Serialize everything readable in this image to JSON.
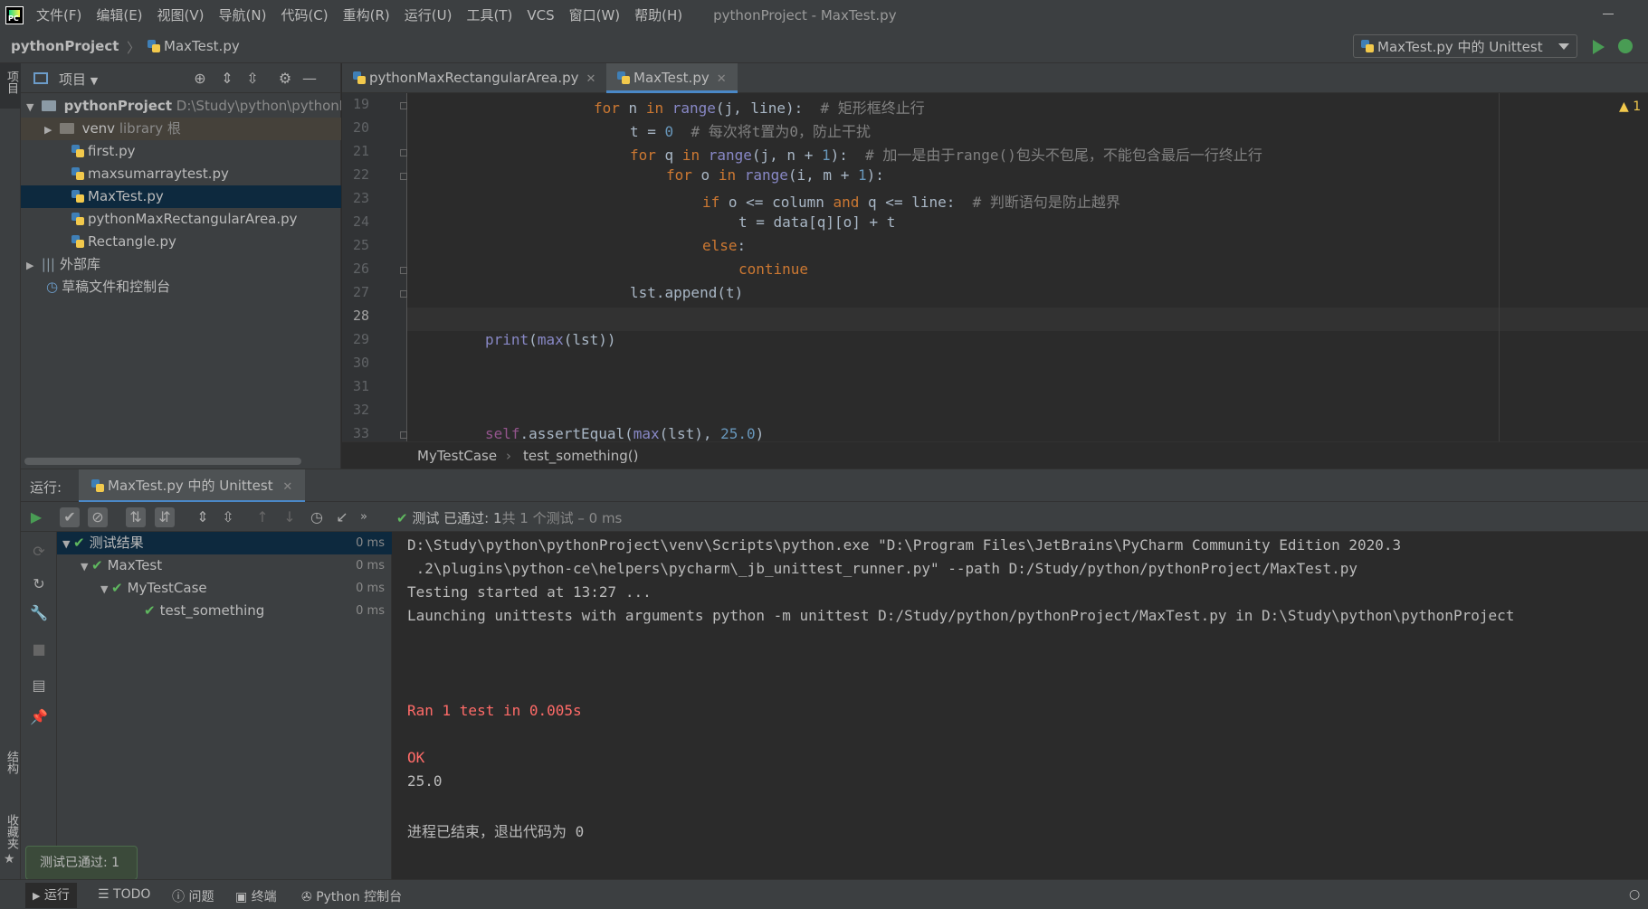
{
  "menubar": {
    "items": [
      "文件(F)",
      "编辑(E)",
      "视图(V)",
      "导航(N)",
      "代码(C)",
      "重构(R)",
      "运行(U)",
      "工具(T)",
      "VCS",
      "窗口(W)",
      "帮助(H)"
    ],
    "window_title": "pythonProject - MaxTest.py",
    "logo_text": "PC"
  },
  "navbar": {
    "project": "pythonProject",
    "separator": "〉",
    "file": "MaxTest.py",
    "run_config": "MaxTest.py 中的 Unittest"
  },
  "left_strip": {
    "project_label": "项目",
    "structure_label": "结构",
    "favorites_label": "收藏夹"
  },
  "project_panel": {
    "title": "项目",
    "tree": [
      {
        "label": "pythonProject",
        "suffix": "D:\\Study\\python\\pythonP"
      },
      {
        "label": "venv",
        "suffix": "library 根"
      },
      {
        "label": "first.py",
        "suffix": ""
      },
      {
        "label": "maxsumarraytest.py",
        "suffix": ""
      },
      {
        "label": "MaxTest.py",
        "suffix": ""
      },
      {
        "label": "pythonMaxRectangularArea.py",
        "suffix": ""
      },
      {
        "label": "Rectangle.py",
        "suffix": ""
      },
      {
        "label": "外部库",
        "suffix": ""
      },
      {
        "label": "草稿文件和控制台",
        "suffix": ""
      }
    ]
  },
  "editor": {
    "tabs": [
      "pythonMaxRectangularArea.py",
      "MaxTest.py"
    ],
    "line_numbers": [
      "19",
      "20",
      "21",
      "22",
      "23",
      "24",
      "25",
      "26",
      "27",
      "28",
      "29",
      "30",
      "31",
      "32",
      "33"
    ],
    "warning": "1",
    "breadcrumb": [
      "MyTestCase",
      "test_something()"
    ]
  },
  "run_panel": {
    "label": "运行:",
    "tab": "MaxTest.py 中的 Unittest",
    "status_prefix": "测试 已通过:",
    "status_count": "1",
    "status_suffix": "共 1 个测试 – 0 ms",
    "results": [
      {
        "label": "测试结果",
        "time": "0 ms"
      },
      {
        "label": "MaxTest",
        "time": "0 ms"
      },
      {
        "label": "MyTestCase",
        "time": "0 ms"
      },
      {
        "label": "test_something",
        "time": "0 ms"
      }
    ],
    "console": [
      "D:\\Study\\python\\pythonProject\\venv\\Scripts\\python.exe \"D:\\Program Files\\JetBrains\\PyCharm Community Edition 2020.3",
      " .2\\plugins\\python-ce\\helpers\\pycharm\\_jb_unittest_runner.py\" --path D:/Study/python/pythonProject/MaxTest.py",
      "Testing started at 13:27 ...",
      "Launching unittests with arguments python -m unittest D:/Study/python/pythonProject/MaxTest.py in D:\\Study\\python\\pythonProject",
      "Ran 1 test in 0.005s",
      "OK",
      "25.0",
      "进程已结束，退出代码为 0"
    ]
  },
  "tooltip": "测试已通过: 1",
  "bottombar": [
    "运行",
    "TODO",
    "问题",
    "终端",
    "Python 控制台"
  ],
  "colors": {
    "accent": "#4a88c7",
    "pass": "#5fb85f",
    "error_text": "#ff6b68",
    "keyword": "#cc7832"
  }
}
